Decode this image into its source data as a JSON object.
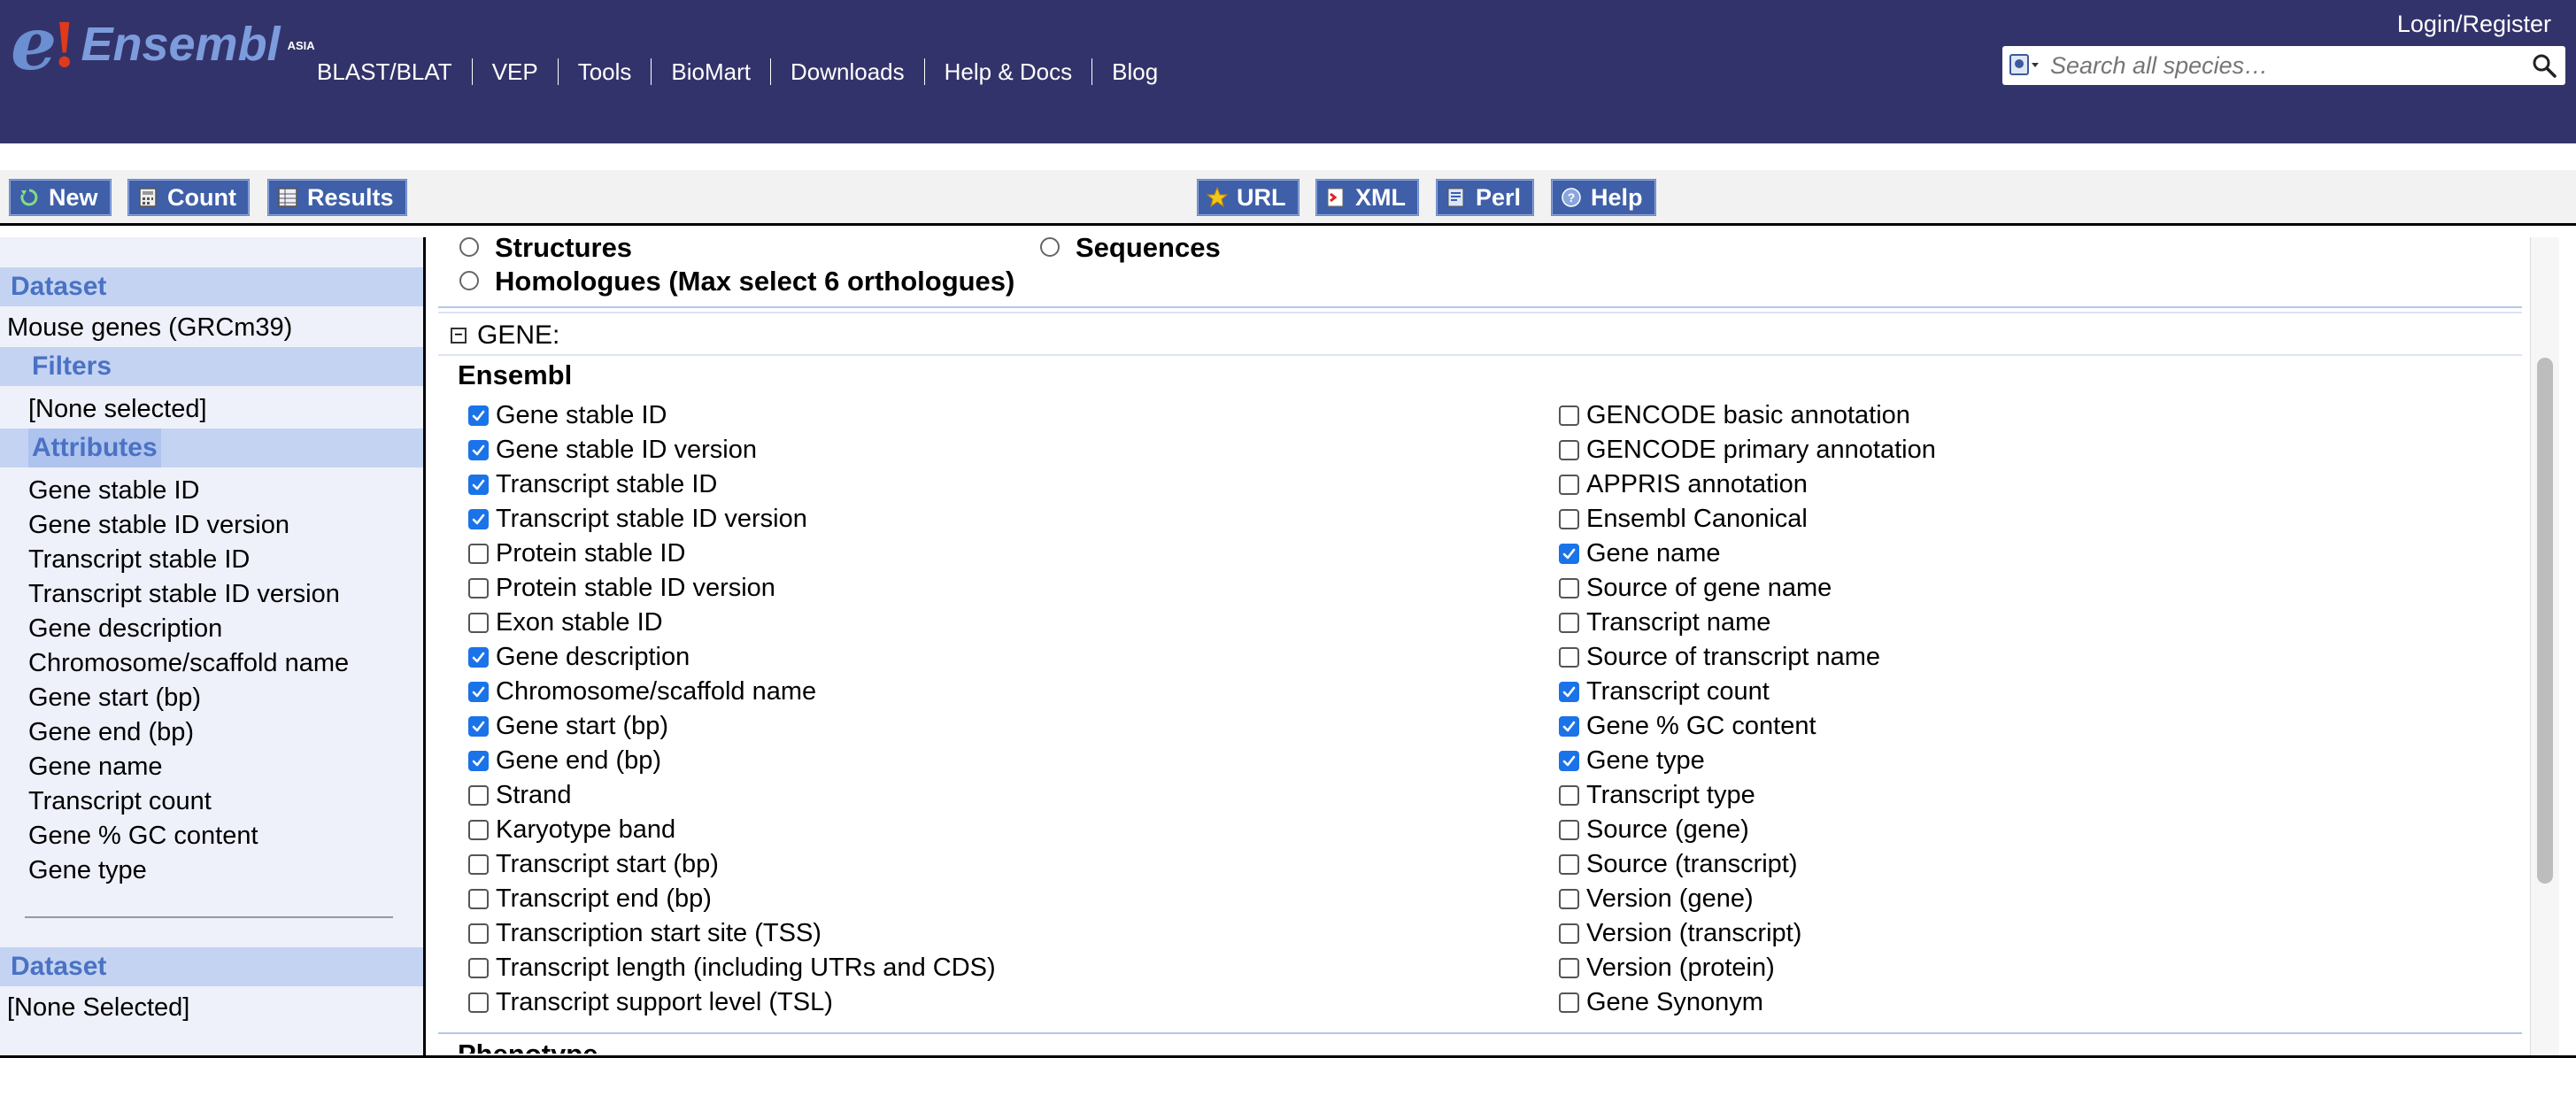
{
  "header": {
    "logo_text": "Ensembl",
    "logo_region": "ASIA",
    "login": "Login/Register",
    "nav": [
      "BLAST/BLAT",
      "VEP",
      "Tools",
      "BioMart",
      "Downloads",
      "Help & Docs",
      "Blog"
    ],
    "search_placeholder": "Search all species…"
  },
  "toolbar": {
    "new": "New",
    "count": "Count",
    "results": "Results",
    "url": "URL",
    "xml": "XML",
    "perl": "Perl",
    "help": "Help"
  },
  "sidebar": {
    "dataset_heading": "Dataset",
    "dataset_value": "Mouse genes (GRCm39)",
    "filters_heading": "Filters",
    "filters_value": "[None selected]",
    "attributes_heading": "Attributes",
    "attributes": [
      "Gene stable ID",
      "Gene stable ID version",
      "Transcript stable ID",
      "Transcript stable ID version",
      "Gene description",
      "Chromosome/scaffold name",
      "Gene start (bp)",
      "Gene end (bp)",
      "Gene name",
      "Transcript count",
      "Gene % GC content",
      "Gene type"
    ],
    "dataset2_heading": "Dataset",
    "dataset2_value": "[None Selected]"
  },
  "main": {
    "radios": [
      "Structures",
      "Sequences",
      "Homologues (Max select 6 orthologues)"
    ],
    "section_title": "GENE:",
    "subsection_title": "Ensembl",
    "left_column": [
      {
        "label": "Gene stable ID",
        "checked": true
      },
      {
        "label": "Gene stable ID version",
        "checked": true
      },
      {
        "label": "Transcript stable ID",
        "checked": true
      },
      {
        "label": "Transcript stable ID version",
        "checked": true
      },
      {
        "label": "Protein stable ID",
        "checked": false
      },
      {
        "label": "Protein stable ID version",
        "checked": false
      },
      {
        "label": "Exon stable ID",
        "checked": false
      },
      {
        "label": "Gene description",
        "checked": true
      },
      {
        "label": "Chromosome/scaffold name",
        "checked": true
      },
      {
        "label": "Gene start (bp)",
        "checked": true
      },
      {
        "label": "Gene end (bp)",
        "checked": true
      },
      {
        "label": "Strand",
        "checked": false
      },
      {
        "label": "Karyotype band",
        "checked": false
      },
      {
        "label": "Transcript start (bp)",
        "checked": false
      },
      {
        "label": "Transcript end (bp)",
        "checked": false
      },
      {
        "label": "Transcription start site (TSS)",
        "checked": false
      },
      {
        "label": "Transcript length (including UTRs and CDS)",
        "checked": false
      },
      {
        "label": "Transcript support level (TSL)",
        "checked": false
      }
    ],
    "right_column": [
      {
        "label": "GENCODE basic annotation",
        "checked": false
      },
      {
        "label": "GENCODE primary annotation",
        "checked": false
      },
      {
        "label": "APPRIS annotation",
        "checked": false
      },
      {
        "label": "Ensembl Canonical",
        "checked": false
      },
      {
        "label": "Gene name",
        "checked": true
      },
      {
        "label": "Source of gene name",
        "checked": false
      },
      {
        "label": "Transcript name",
        "checked": false
      },
      {
        "label": "Source of transcript name",
        "checked": false
      },
      {
        "label": "Transcript count",
        "checked": true
      },
      {
        "label": "Gene % GC content",
        "checked": true
      },
      {
        "label": "Gene type",
        "checked": true
      },
      {
        "label": "Transcript type",
        "checked": false
      },
      {
        "label": "Source (gene)",
        "checked": false
      },
      {
        "label": "Source (transcript)",
        "checked": false
      },
      {
        "label": "Version (gene)",
        "checked": false
      },
      {
        "label": "Version (transcript)",
        "checked": false
      },
      {
        "label": "Version (protein)",
        "checked": false
      },
      {
        "label": "Gene Synonym",
        "checked": false
      }
    ],
    "next_section_title": "Phenotype"
  },
  "colors": {
    "masthead": "#33336b",
    "button": "#3f5fa8",
    "sidebar_heading": "#c4d3f2",
    "sidebar_bg": "#eef0fa",
    "checkbox_checked": "#1a73e8"
  }
}
